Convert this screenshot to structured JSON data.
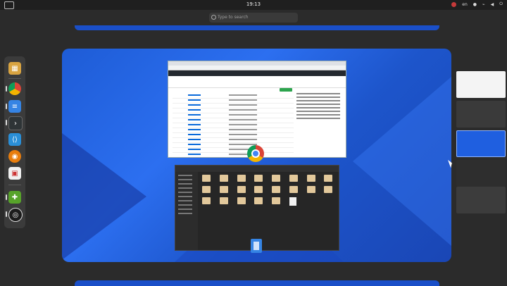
{
  "topbar": {
    "clock": "19:13",
    "lang": "en"
  },
  "search": {
    "placeholder": "Type to search"
  },
  "dock": {
    "apps": [
      {
        "name": "app-grid",
        "color": "#d9a441"
      },
      {
        "name": "chrome",
        "color": "#4285f4"
      },
      {
        "name": "text-editor",
        "color": "#3584e4"
      },
      {
        "name": "terminal",
        "color": "#2e3436"
      },
      {
        "name": "vscode",
        "color": "#2a8fd8"
      },
      {
        "name": "blender",
        "color": "#e87d0d"
      },
      {
        "name": "software-center",
        "color": "#f0f0f0"
      },
      {
        "name": "extensions",
        "color": "#57a32a"
      },
      {
        "name": "obs",
        "color": "#1b1b1b"
      }
    ]
  },
  "workspace_colors": {
    "primary": "#2c6ff0",
    "dark": "#1a46b5"
  }
}
